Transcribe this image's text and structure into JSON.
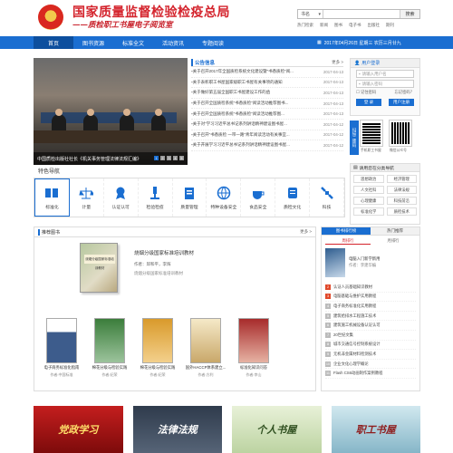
{
  "header": {
    "title": "国家质量监督检验检疫总局",
    "subtitle": "——质检职工书屋电子阅览室",
    "search": {
      "scope": "书名",
      "placeholder": "",
      "button": "搜索"
    },
    "links": [
      "热门检索",
      "新闻",
      "图书",
      "电子书",
      "出版社",
      "期刊"
    ]
  },
  "nav": {
    "items": [
      "首页",
      "图书资源",
      "标准全文",
      "活动资讯",
      "专题阅读"
    ],
    "date": "2017年04月26日 星期三 农历三月廿九"
  },
  "banner": {
    "caption": "中国质检出版社社长《机关事务管理法律法规汇编》",
    "pages": [
      "1",
      "2",
      "3",
      "4",
      "5"
    ]
  },
  "notices": {
    "title": "公告信息",
    "more": "更多 >",
    "items": [
      {
        "text": "关于召开2017年全国质检系统文化建设暨“书香质检”阅...",
        "date": "2017-04-13"
      },
      {
        "text": "关于表彰职工书屋国家级职工书屋有关事项的通知",
        "date": "2017-04-13"
      },
      {
        "text": "关于做好第五届全国职工书屋建设工作的函",
        "date": "2017-04-13"
      },
      {
        "text": "关于召开全国质检系统“书香质检”阅读活动推荐图书...",
        "date": "2017-04-13"
      },
      {
        "text": "关于召开全国质检系统“书香质检”阅读活动推荐图...",
        "date": "2017-04-13"
      },
      {
        "text": "关于对“学习习近平总书记系列讲话精神建设图书屋...",
        "date": "2017-04-12"
      },
      {
        "text": "关于召开“书香质检 一带一路”青年阅读活动有关事宜...",
        "date": "2017-04-12"
      },
      {
        "text": "关于开展学习习近平总书记系列讲话精神建设图书屋...",
        "date": "2017-04-12"
      }
    ]
  },
  "login": {
    "title": "用户登录",
    "username_placeholder": "请输入用户名",
    "password_placeholder": "请输入密码",
    "remember": "记住密码",
    "forgot": "忘记密码？",
    "login_btn": "登 录",
    "register_btn": "用户注册"
  },
  "qr": {
    "label": "扫描二维码",
    "captions": [
      "手机职工书屋",
      "微信公众号"
    ]
  },
  "guide": {
    "title": "请用您在分类导航",
    "items": [
      "思想政治",
      "经济管理",
      "人文社科",
      "法律法规",
      "心理健康",
      "科技前沿",
      "标准化学",
      "质检技术"
    ]
  },
  "features": {
    "title": "特色导航",
    "items": [
      "标准化",
      "计量",
      "认证认可",
      "检验检疫",
      "质量管理",
      "特种设备安全",
      "食品安全",
      "质检文化",
      "科技"
    ]
  },
  "recommend": {
    "title": "推荐图书",
    "more": "更多 >",
    "featured": {
      "name": "烧烟分级国家标准培训教材",
      "author": "作者：邱和平，李辉",
      "intro": "烧烟分级国家标准培训教材"
    },
    "books": [
      {
        "name": "电子商务标准化指南",
        "author": "作者:中国标准"
      },
      {
        "name": "棉花分级与检验实践",
        "author": "作者:纪荣"
      },
      {
        "name": "棉花分级与检验实践",
        "author": "作者:纪荣"
      },
      {
        "name": "国外HACCP体系建立...",
        "author": "作者:方利"
      },
      {
        "name": "标准化知识问答",
        "author": "作者:李山"
      }
    ]
  },
  "ranking": {
    "tabs": [
      "图书排行榜",
      "热门推荐"
    ],
    "subtabs": [
      "周排行",
      "月排行"
    ],
    "top": {
      "name": "电脑入门新学新用",
      "author": "作者：李建华编"
    },
    "items": [
      "认证人员基础知识教材",
      "电脑基础与维护实用教程",
      "电子商务标准化实用教程",
      "建筑给排水工程施工技术",
      "建筑施工机械设备认证认可",
      "20世纪文集",
      "城市交通信号控制系统设计",
      "无机非金属材料检测技术",
      "企业文化心理学概论",
      "Flash CS6动画制作案例教程"
    ]
  },
  "promos": [
    "党政学习",
    "法律法规",
    "个人书屋",
    "职工书屋"
  ]
}
